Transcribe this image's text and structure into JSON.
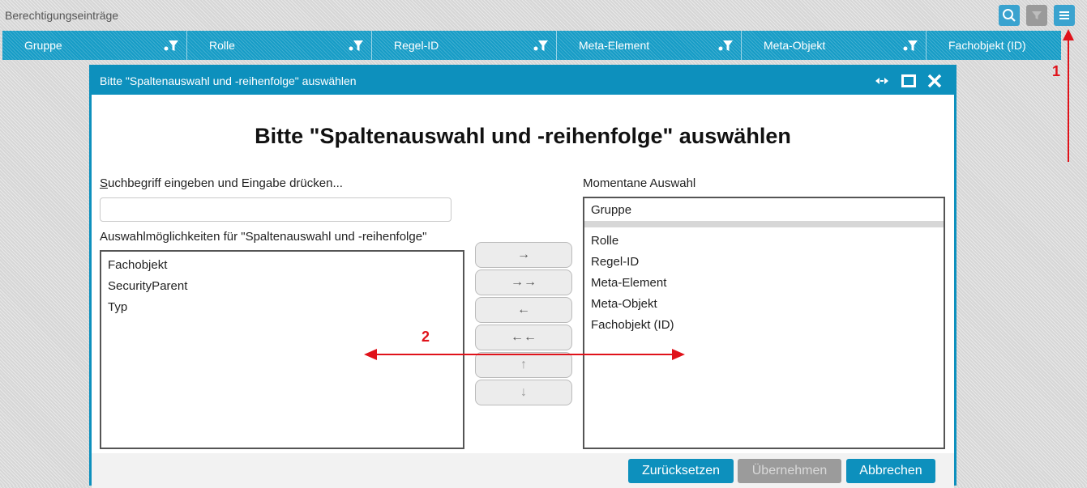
{
  "window": {
    "title": "Berechtigungseinträge"
  },
  "toolbar": {
    "search_icon": "search-icon",
    "filter_icon": "filter-icon",
    "menu_icon": "hamburger-menu-icon"
  },
  "columns": [
    {
      "label": "Gruppe"
    },
    {
      "label": "Rolle"
    },
    {
      "label": "Regel-ID"
    },
    {
      "label": "Meta-Element"
    },
    {
      "label": "Meta-Objekt"
    },
    {
      "label": "Fachobjekt (ID)"
    }
  ],
  "annotations": {
    "marker1": "1",
    "marker2": "2",
    "color": "#e0121a"
  },
  "dialog": {
    "title": "Bitte \"Spaltenauswahl und -reihenfolge\" auswählen",
    "heading": "Bitte \"Spaltenauswahl und -reihenfolge\" auswählen",
    "search_label_first": "S",
    "search_label_rest": "uchbegriff eingeben und Eingabe drücken...",
    "search_value": "",
    "available_label": "Auswahlmöglichkeiten für \"Spaltenauswahl und -reihenfolge\"",
    "available_items": [
      "Fachobjekt",
      "SecurityParent",
      "Typ"
    ],
    "selected_label": "Momentane Auswahl",
    "selected_first": "Gruppe",
    "selected_items": [
      "Rolle",
      "Regel-ID",
      "Meta-Element",
      "Meta-Objekt",
      "Fachobjekt (ID)"
    ],
    "move_buttons": {
      "add": "→",
      "add_all": "→→",
      "remove": "←",
      "remove_all": "←←",
      "up": "↑",
      "down": "↓"
    },
    "footer": {
      "reset": "Zurücksetzen",
      "apply": "Übernehmen",
      "cancel": "Abbrechen"
    }
  },
  "colors": {
    "header_blue": "#169cc6",
    "dialog_blue": "#0d90bd",
    "disabled_gray": "#9b9b9b"
  }
}
